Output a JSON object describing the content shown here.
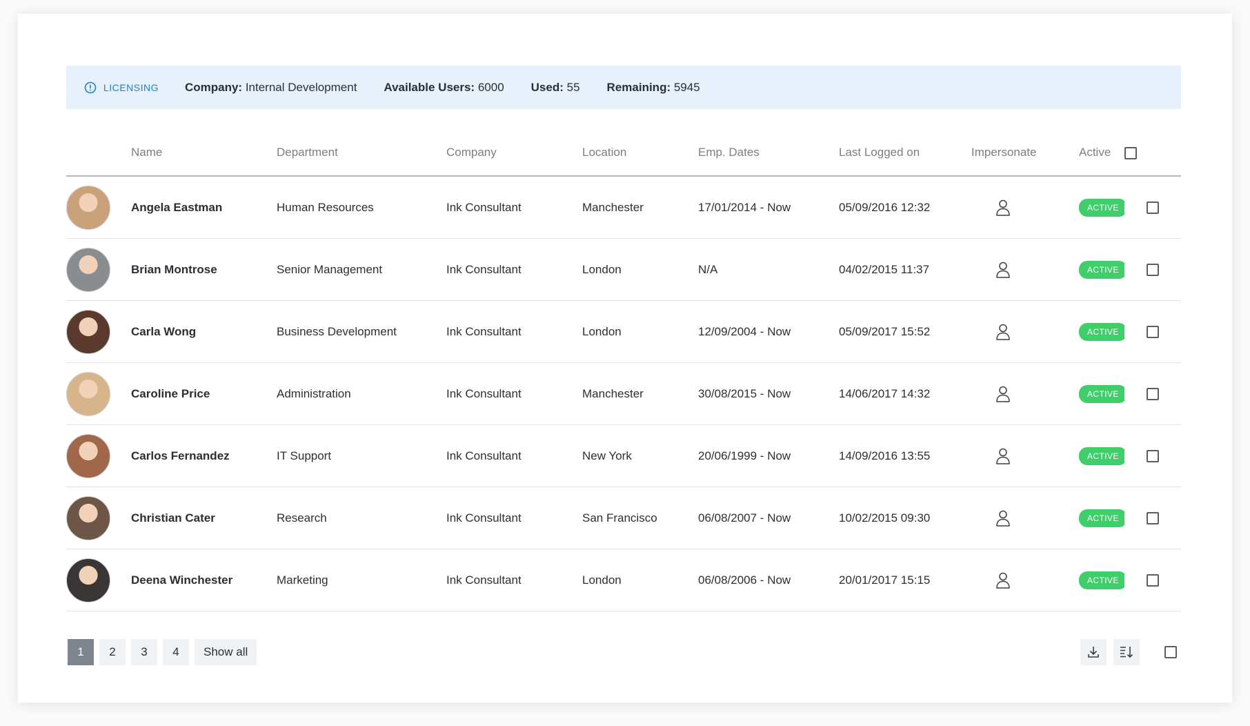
{
  "banner": {
    "label": "LICENSING",
    "company_label": "Company:",
    "company_value": "Internal Development",
    "available_label": "Available Users:",
    "available_value": "6000",
    "used_label": "Used:",
    "used_value": "55",
    "remaining_label": "Remaining:",
    "remaining_value": "5945"
  },
  "table": {
    "headers": [
      "Name",
      "Department",
      "Company",
      "Location",
      "Emp. Dates",
      "Last Logged on",
      "Impersonate",
      "Active"
    ],
    "rows": [
      {
        "name": "Angela Eastman",
        "department": "Human Resources",
        "company": "Ink Consultant",
        "location": "Manchester",
        "dates": "17/01/2014 - Now",
        "last_logged": "05/09/2016 12:32",
        "status": "ACTIVE",
        "avatar_color": "#c9a27a"
      },
      {
        "name": "Brian Montrose",
        "department": "Senior Management",
        "company": "Ink Consultant",
        "location": "London",
        "dates": "N/A",
        "last_logged": "04/02/2015 11:37",
        "status": "ACTIVE",
        "avatar_color": "#8a8d90"
      },
      {
        "name": "Carla Wong",
        "department": "Business Development",
        "company": "Ink Consultant",
        "location": "London",
        "dates": "12/09/2004 - Now",
        "last_logged": "05/09/2017 15:52",
        "status": "ACTIVE",
        "avatar_color": "#5a3a2c"
      },
      {
        "name": "Caroline Price",
        "department": "Administration",
        "company": "Ink Consultant",
        "location": "Manchester",
        "dates": "30/08/2015 - Now",
        "last_logged": "14/06/2017 14:32",
        "status": "ACTIVE",
        "avatar_color": "#d8b48a"
      },
      {
        "name": "Carlos Fernandez",
        "department": "IT Support",
        "company": "Ink Consultant",
        "location": "New York",
        "dates": "20/06/1999 - Now",
        "last_logged": "14/09/2016 13:55",
        "status": "ACTIVE",
        "avatar_color": "#a0674a"
      },
      {
        "name": "Christian Cater",
        "department": "Research",
        "company": "Ink Consultant",
        "location": "San Francisco",
        "dates": "06/08/2007 - Now",
        "last_logged": "10/02/2015 09:30",
        "status": "ACTIVE",
        "avatar_color": "#6e5646"
      },
      {
        "name": "Deena Winchester",
        "department": "Marketing",
        "company": "Ink Consultant",
        "location": "London",
        "dates": "06/08/2006 - Now",
        "last_logged": "20/01/2017 15:15",
        "status": "ACTIVE",
        "avatar_color": "#3b3636"
      }
    ]
  },
  "pagination": {
    "pages": [
      "1",
      "2",
      "3",
      "4"
    ],
    "show_all": "Show all"
  },
  "colors": {
    "accent": "#1d7ed3",
    "active_badge": "#3ecf6a",
    "banner_bg": "#e6f1fb",
    "pager_active": "#7d858e"
  },
  "icons": {
    "banner": "info-icon",
    "impersonate": "person-icon",
    "download": "download-icon",
    "sort": "sort-icon"
  }
}
